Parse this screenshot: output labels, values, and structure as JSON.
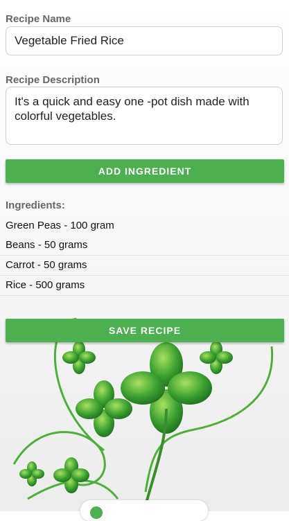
{
  "form": {
    "name_label": "Recipe Name",
    "name_value": "Vegetable Fried Rice",
    "description_label": "Recipe Description",
    "description_value": "It's a quick and easy one -pot dish made with colorful vegetables.",
    "add_ingredient_label": "ADD INGREDIENT",
    "ingredients_label": "Ingredients:",
    "ingredients": [
      "Green Peas - 100 gram",
      "Beans - 50 grams",
      "Carrot - 50 grams",
      "Rice - 500 grams"
    ],
    "save_label": "SAVE RECIPE"
  },
  "colors": {
    "accent": "#4caf50",
    "label": "#666666"
  },
  "background_icon": "clover-icon"
}
